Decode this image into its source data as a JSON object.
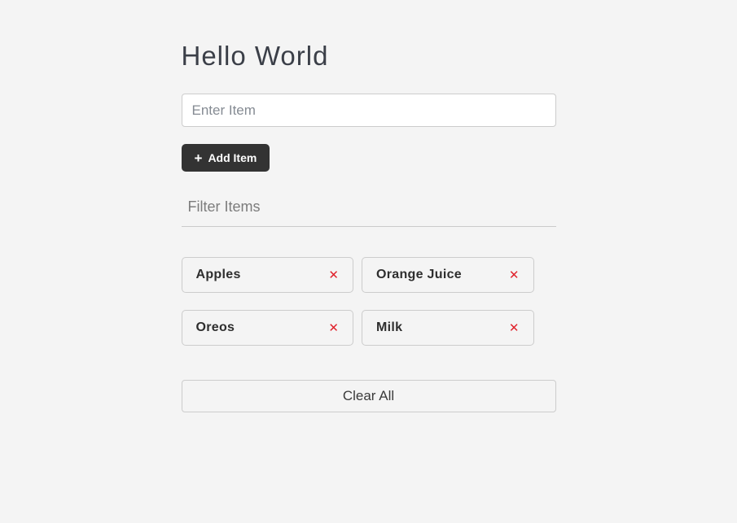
{
  "app": {
    "title": "Hello World"
  },
  "add_item": {
    "input_placeholder": "Enter Item",
    "button_label": "Add Item"
  },
  "filter": {
    "placeholder": "Filter Items"
  },
  "items": [
    {
      "label": "Apples"
    },
    {
      "label": "Orange Juice"
    },
    {
      "label": "Oreos"
    },
    {
      "label": "Milk"
    }
  ],
  "footer": {
    "clear_all_label": "Clear All"
  },
  "icons": {
    "plus": "+",
    "close": "✕"
  },
  "colors": {
    "page_background": "#f4f4f4",
    "button_dark": "#333333",
    "remove_red": "#e0232d",
    "border_gray": "#cccccc"
  }
}
